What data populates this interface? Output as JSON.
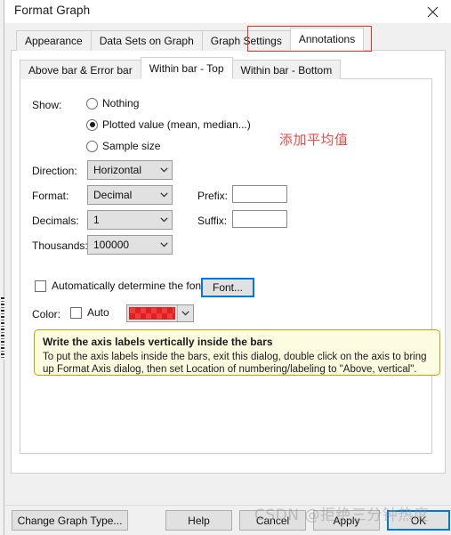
{
  "window": {
    "title": "Format Graph",
    "close_icon": "close-icon"
  },
  "outer_tabs": [
    {
      "label": "Appearance",
      "active": false
    },
    {
      "label": "Data Sets on Graph",
      "active": false
    },
    {
      "label": "Graph Settings",
      "active": false
    },
    {
      "label": "Annotations",
      "active": true
    }
  ],
  "inner_tabs": [
    {
      "label": "Above bar & Error bar",
      "active": false
    },
    {
      "label": "Within bar - Top",
      "active": true
    },
    {
      "label": "Within bar - Bottom",
      "active": false
    }
  ],
  "form": {
    "show_label": "Show:",
    "show_options": [
      {
        "label": "Nothing",
        "selected": false
      },
      {
        "label": "Plotted value (mean, median...)",
        "selected": true
      },
      {
        "label": "Sample size",
        "selected": false
      }
    ],
    "direction_label": "Direction:",
    "direction_value": "Horizontal",
    "format_label": "Format:",
    "format_value": "Decimal",
    "decimals_label": "Decimals:",
    "decimals_value": "1",
    "thousands_label": "Thousands:",
    "thousands_value": "100000",
    "prefix_label": "Prefix:",
    "prefix_value": "",
    "prefix_placeholder": "",
    "suffix_label": "Suffix:",
    "suffix_value": "",
    "suffix_placeholder": "",
    "auto_font_label": "Automatically determine the font",
    "auto_font_checked": false,
    "font_button_label": "Font...",
    "color_label": "Color:",
    "color_auto_label": "Auto",
    "color_auto_checked": false,
    "color_value": "#f03c3c",
    "dropdown_arrow_icon": "chevron-down-icon"
  },
  "tip": {
    "title": "Write the axis labels vertically inside the bars",
    "body": "To put the axis labels inside the bars, exit this dialog, double click on the axis to bring up Format Axis dialog, then set Location of numbering/labeling to \"Above, vertical\"."
  },
  "annotations": {
    "tab_highlight_color": "#ea3323",
    "note_text": "添加平均值",
    "note_color": "#ee4a48"
  },
  "footer": {
    "change_graph_type": "Change Graph Type...",
    "help": "Help",
    "cancel": "Cancel",
    "apply": "Apply",
    "ok": "OK"
  },
  "watermark": {
    "text": "CSDN @拒绝三分钟热度"
  }
}
